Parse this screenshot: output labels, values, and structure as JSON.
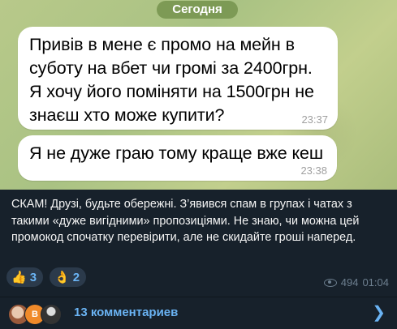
{
  "date_chip": "Сегодня",
  "messages": [
    {
      "text": "Привів в мене є промо на мейн в суботу на вбет чи громі за 2400грн. Я хочу його поміняти на 1500грн не знаєш хто може купити?",
      "time": "23:37"
    },
    {
      "text": "Я не дуже граю тому краще вже кеш",
      "time": "23:38"
    }
  ],
  "caption": "СКАМ! Друзі, будьте обережні. З’явився спам в групах і чатах з такими «дуже вигідними» пропозиціями. Не знаю, чи можна цей промокод спочатку перевірити, але не скидайте гроші наперед.",
  "reactions": [
    {
      "emoji": "👍",
      "icon": "thumbs-up-icon",
      "count": "3"
    },
    {
      "emoji": "👌",
      "icon": "ok-hand-icon",
      "count": "2"
    }
  ],
  "meta": {
    "views": "494",
    "time": "01:04"
  },
  "comments": {
    "avatar_letter": "B",
    "label": "13 комментариев",
    "icon": "chevron-right-icon"
  },
  "colors": {
    "accent": "#6ab3f3",
    "background": "#17212b"
  }
}
